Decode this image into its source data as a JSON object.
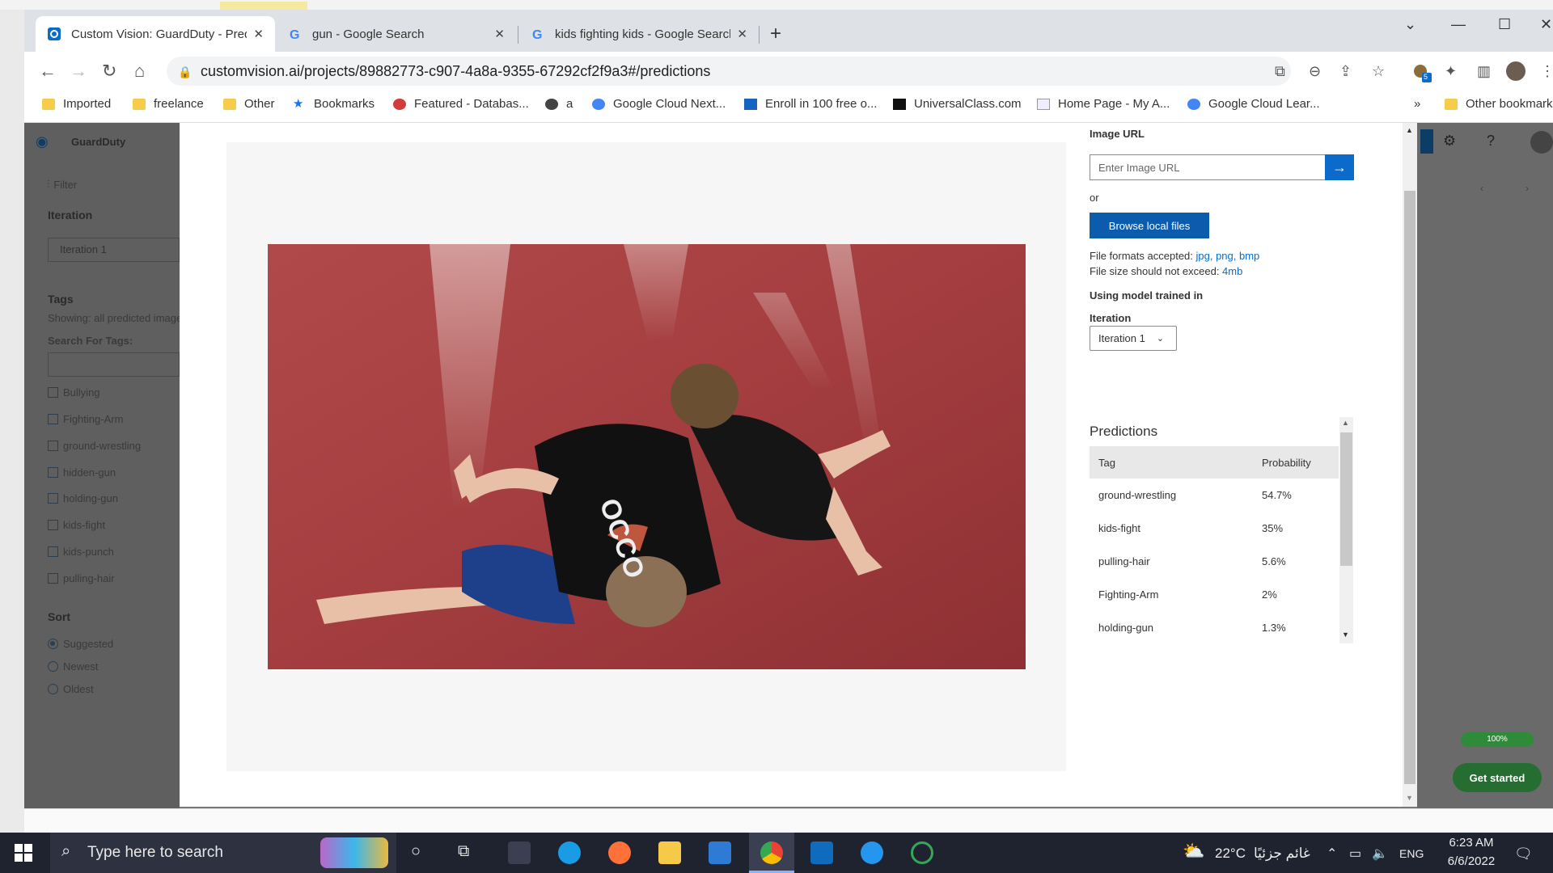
{
  "browser": {
    "tabs": [
      {
        "title": "Custom Vision: GuardDuty - Predictions",
        "active": true
      },
      {
        "title": "gun - Google Search",
        "active": false
      },
      {
        "title": "kids fighting kids - Google Search",
        "active": false
      }
    ],
    "url": "customvision.ai/projects/89882773-c907-4a8a-9355-67292cf2f9a3#/predictions",
    "bookmarks": [
      "Imported",
      "freelance",
      "Other",
      "Bookmarks",
      "Featured - Databas...",
      "a",
      "Google Cloud Next...",
      "Enroll in 100 free o...",
      "UniversalClass.com",
      "Home Page - My A...",
      "Google Cloud Lear..."
    ],
    "bookmarks_overflow": "»",
    "other_bookmarks": "Other bookmarks",
    "extension_badge": "5"
  },
  "app": {
    "name": "GuardDuty"
  },
  "sidebar": {
    "filter_label": "Filter",
    "iteration_heading": "Iteration",
    "iteration_value": "Iteration 1",
    "tags_heading": "Tags",
    "showing_text": "Showing: all predicted images",
    "search_tags_label": "Search For Tags:",
    "tags": [
      "Bullying",
      "Fighting-Arm",
      "ground-wrestling",
      "hidden-gun",
      "holding-gun",
      "kids-fight",
      "kids-punch",
      "pulling-hair"
    ],
    "sort_heading": "Sort",
    "sort_options": [
      "Suggested",
      "Newest",
      "Oldest"
    ],
    "sort_selected": "Suggested"
  },
  "modal": {
    "image_url_label": "Image URL",
    "image_url_placeholder": "Enter Image URL",
    "or_text": "or",
    "browse_button": "Browse local files",
    "formats_prefix": "File formats accepted: ",
    "formats_list": "jpg, png, bmp",
    "size_prefix": "File size should not exceed: ",
    "size_value": "4mb",
    "model_label": "Using model trained in",
    "iteration_label": "Iteration",
    "iteration_value": "Iteration 1",
    "predictions_title": "Predictions",
    "table_headers": [
      "Tag",
      "Probability"
    ],
    "predictions": [
      {
        "tag": "ground-wrestling",
        "probability": "54.7%"
      },
      {
        "tag": "kids-fight",
        "probability": "35%"
      },
      {
        "tag": "pulling-hair",
        "probability": "5.6%"
      },
      {
        "tag": "Fighting-Arm",
        "probability": "2%"
      },
      {
        "tag": "holding-gun",
        "probability": "1.3%"
      }
    ]
  },
  "background_right": {
    "progress_badge": "100%",
    "get_started": "Get started"
  },
  "taskbar": {
    "search_placeholder": "Type here to search",
    "weather_temp": "22°C",
    "weather_text": "غائم جزئيًا",
    "language": "ENG",
    "time": "6:23 AM",
    "date": "6/6/2022"
  }
}
